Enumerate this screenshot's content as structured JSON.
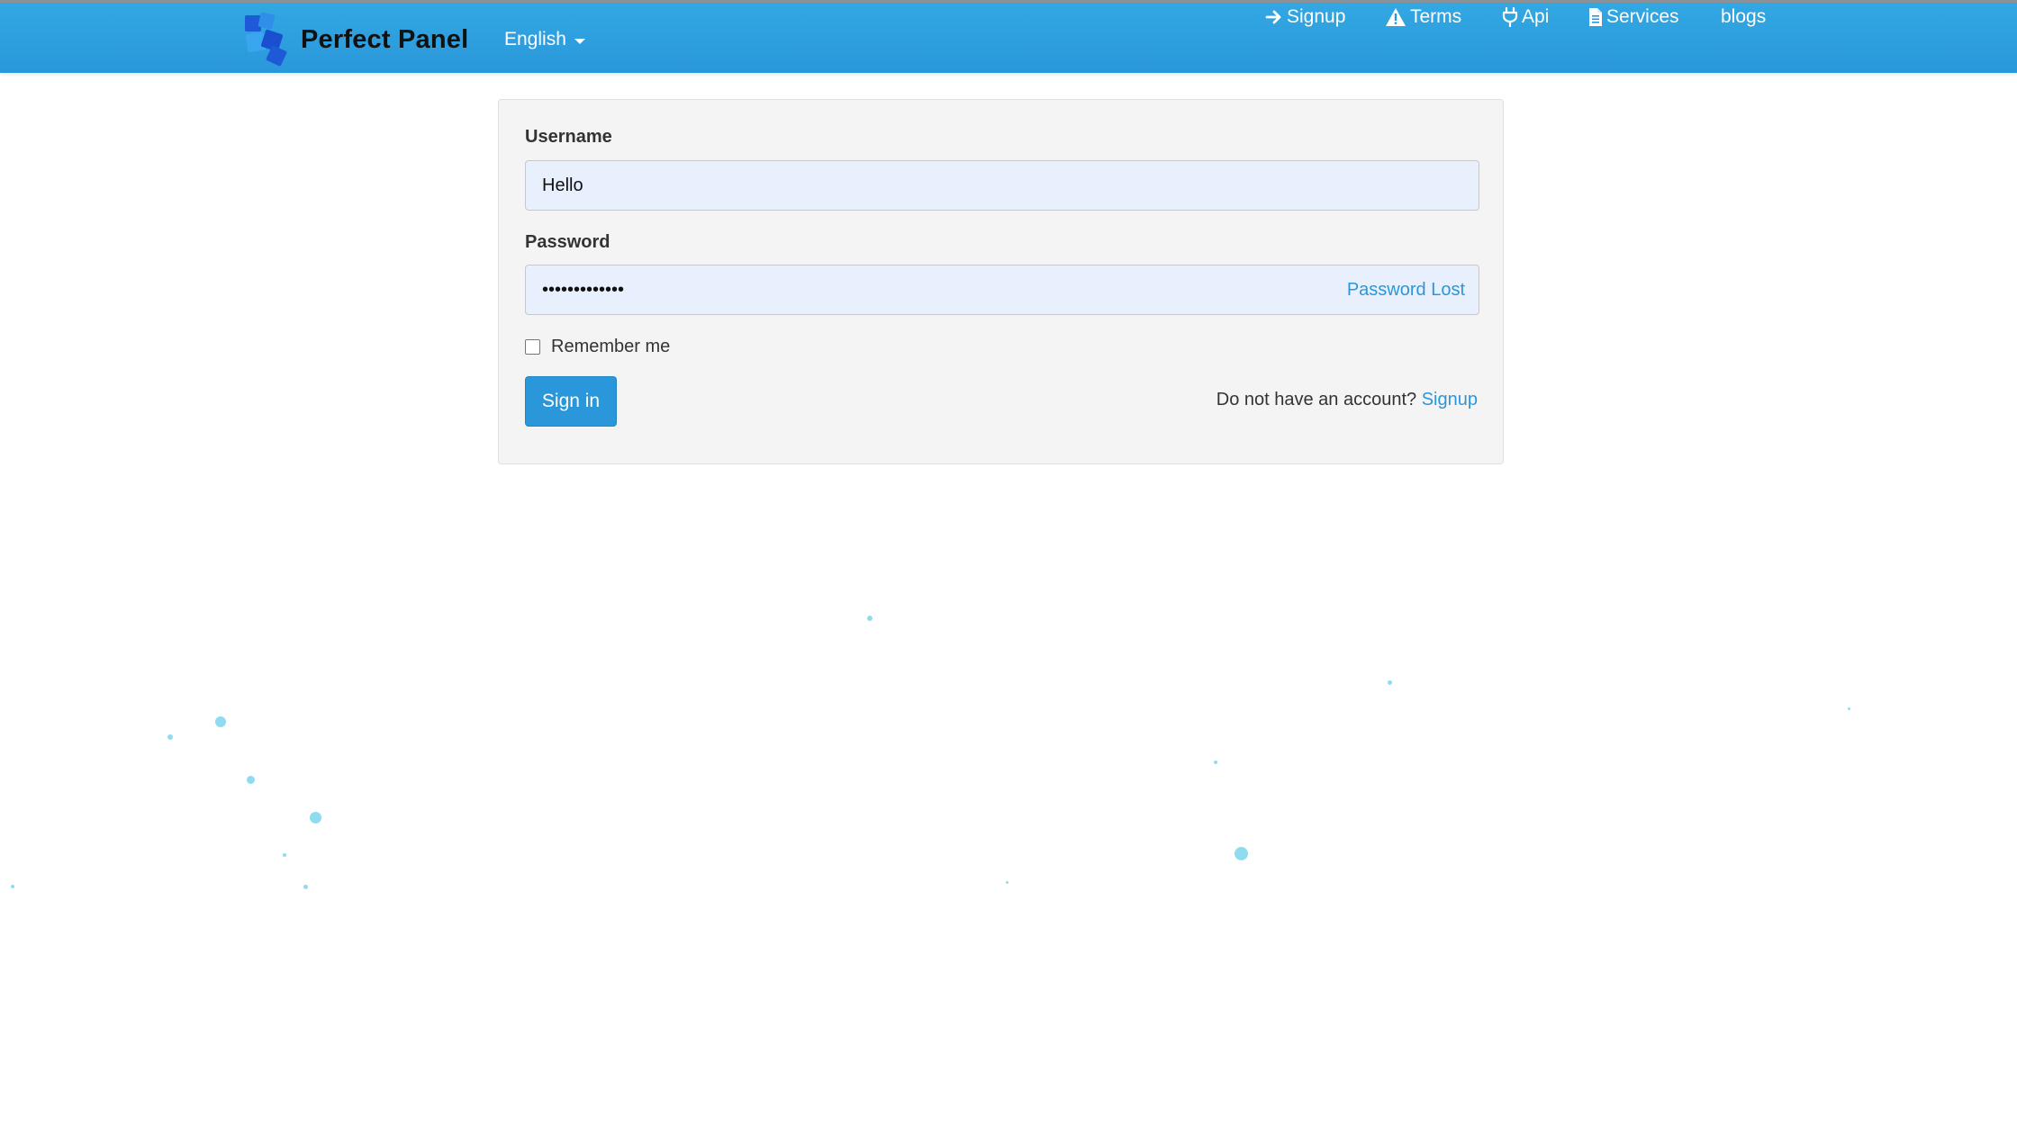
{
  "header": {
    "brand_name": "Perfect Panel",
    "language": "English",
    "nav": [
      {
        "label": "Signup",
        "icon": "arrow-right-icon"
      },
      {
        "label": "Terms",
        "icon": "warning-icon"
      },
      {
        "label": "Api",
        "icon": "plug-icon"
      },
      {
        "label": "Services",
        "icon": "document-icon"
      },
      {
        "label": "blogs",
        "icon": ""
      }
    ]
  },
  "login": {
    "username_label": "Username",
    "username_value": "Hello",
    "password_label": "Password",
    "password_value": "•••••••••••••",
    "password_lost": "Password Lost",
    "remember_label": "Remember me",
    "signin_label": "Sign in",
    "no_account_text": "Do not have an account?",
    "signup_link": "Signup"
  },
  "colors": {
    "accent": "#2a97da",
    "header_top": "#32a8e3",
    "input_bg": "#e8f0fe",
    "panel_bg": "#f4f4f4",
    "particles": "#8fdcf0"
  }
}
